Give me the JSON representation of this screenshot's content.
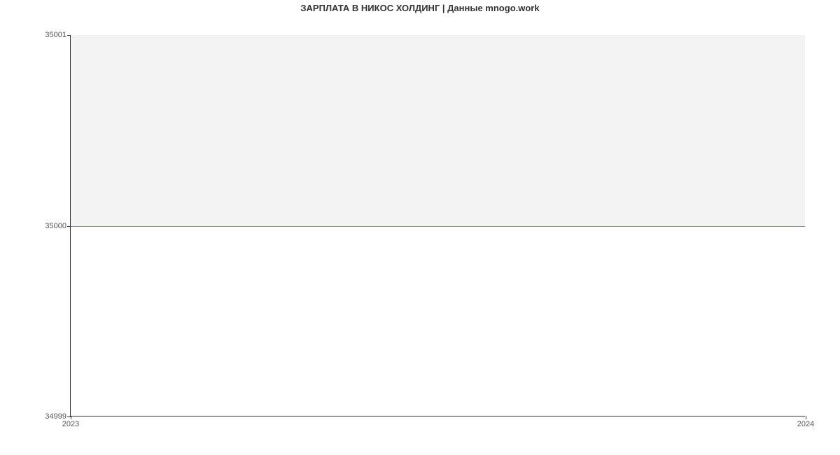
{
  "chart_data": {
    "type": "line",
    "title": "ЗАРПЛАТА В НИКОС ХОЛДИНГ | Данные mnogo.work",
    "xlabel": "",
    "ylabel": "",
    "x": [
      2023,
      2024
    ],
    "values": [
      35000,
      35000
    ],
    "ylim": [
      34999,
      35001
    ],
    "y_ticks": [
      34999,
      35000,
      35001
    ],
    "x_ticks": [
      2023,
      2024
    ],
    "line_color": "#6691c9",
    "plot_band_upper_bg": "#f3f3f3"
  },
  "ticks": {
    "y0": "34999",
    "y1": "35000",
    "y2": "35001",
    "x0": "2023",
    "x1": "2024"
  }
}
